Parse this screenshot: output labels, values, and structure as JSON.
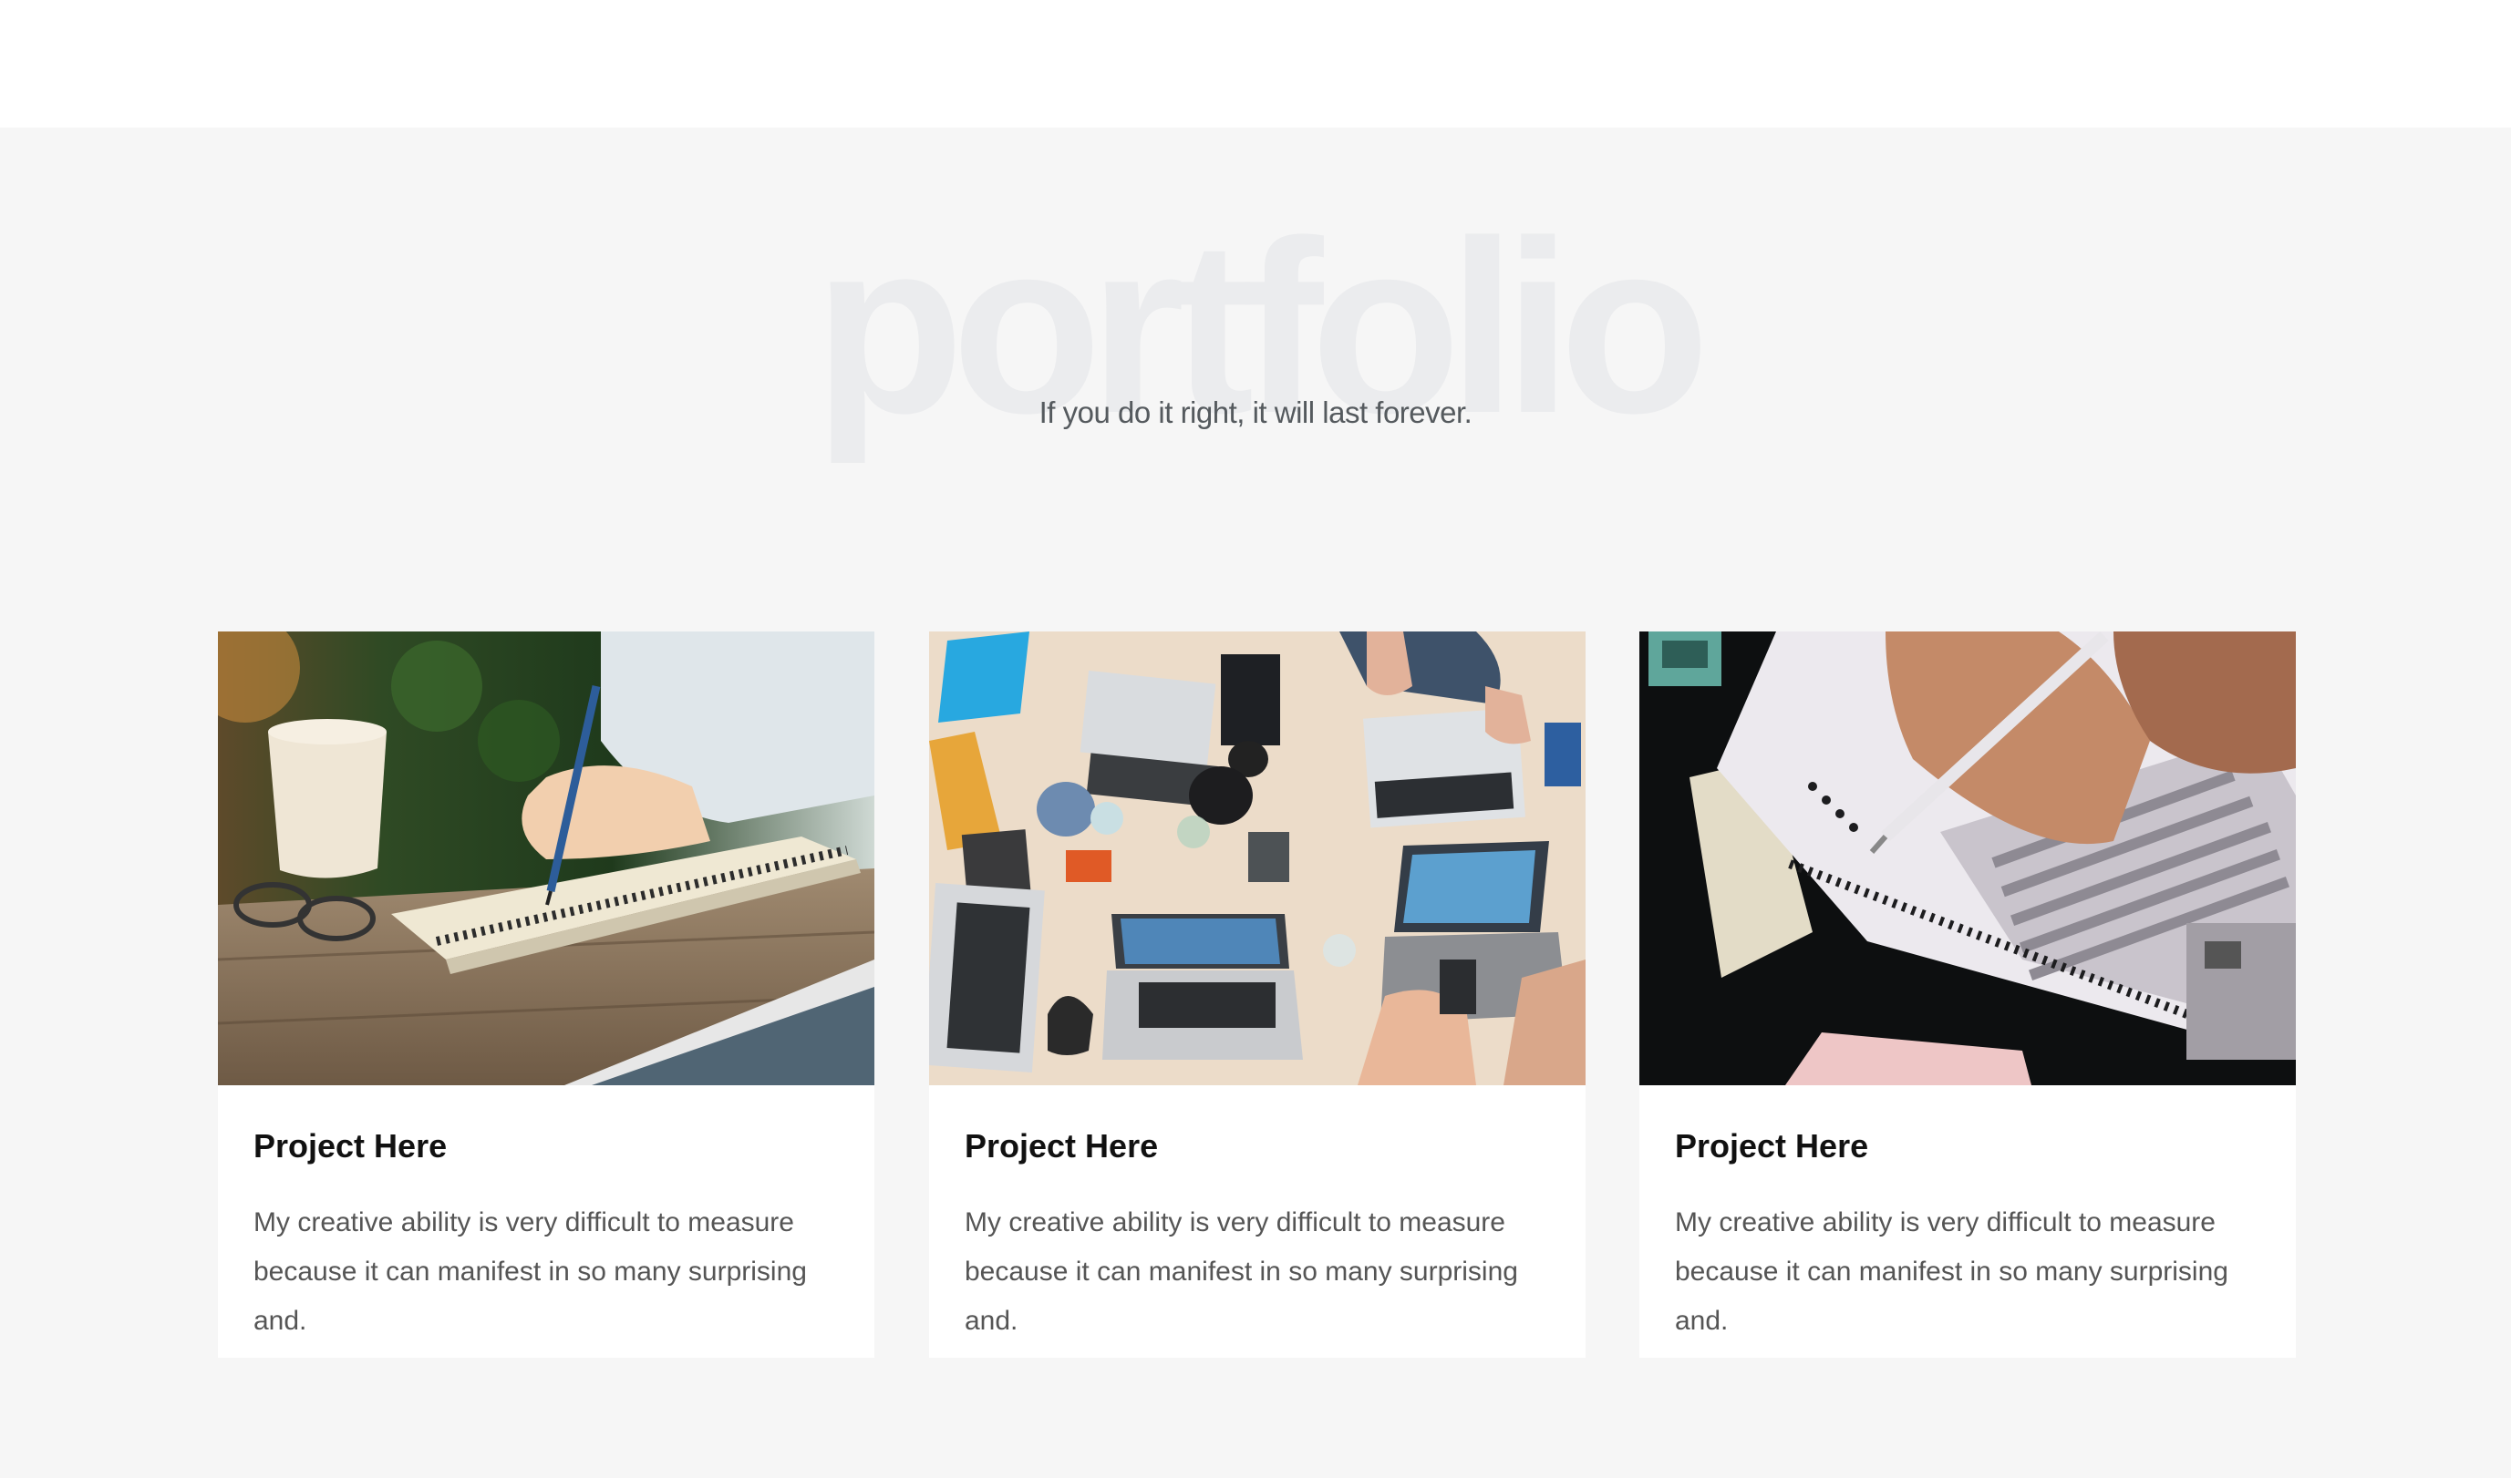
{
  "header": {
    "background_word": "portfolio",
    "subtitle": "If you do it right, it will last forever."
  },
  "cards": [
    {
      "title": "Project Here",
      "description": "My creative ability is very difficult to measure because it can manifest in so many surprising and."
    },
    {
      "title": "Project Here",
      "description": "My creative ability is very difficult to measure because it can manifest in so many surprising and."
    },
    {
      "title": "Project Here",
      "description": "My creative ability is very difficult to measure because it can manifest in so many surprising and."
    }
  ],
  "colors": {
    "background": "#f6f6f6",
    "card": "#ffffff",
    "title": "#111111",
    "text": "#555555",
    "watermark": "#ebecee"
  }
}
